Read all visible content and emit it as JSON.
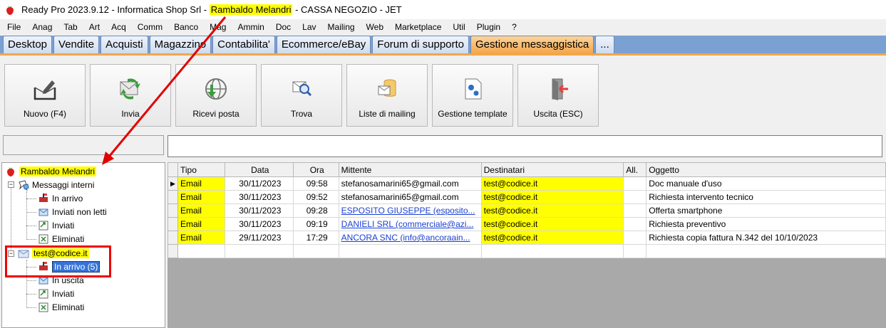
{
  "window": {
    "title_prefix": "Ready Pro 2023.9.12 - Informatica Shop Srl - ",
    "title_user": "Rambaldo Melandri",
    "title_suffix": " - CASSA NEGOZIO - JET"
  },
  "menu": [
    "File",
    "Anag",
    "Tab",
    "Art",
    "Acq",
    "Comm",
    "Banco",
    "Mag",
    "Ammin",
    "Doc",
    "Lav",
    "Mailing",
    "Web",
    "Marketplace",
    "Util",
    "Plugin",
    "?"
  ],
  "tabs": [
    {
      "label": "Desktop",
      "active": false
    },
    {
      "label": "Vendite",
      "active": false
    },
    {
      "label": "Acquisti",
      "active": false
    },
    {
      "label": "Magazzino",
      "active": false
    },
    {
      "label": "Contabilita'",
      "active": false
    },
    {
      "label": "Ecommerce/eBay",
      "active": false
    },
    {
      "label": "Forum di supporto",
      "active": false
    },
    {
      "label": "Gestione messaggistica",
      "active": true
    },
    {
      "label": "...",
      "active": false
    }
  ],
  "toolbar": {
    "new_label": "Nuovo (F4)",
    "send_label": "Invia",
    "receive_label": "Ricevi posta",
    "find_label": "Trova",
    "mailing_lists_label": "Liste di mailing",
    "templates_label": "Gestione template",
    "exit_label": "Uscita (ESC)"
  },
  "search": {
    "left_value": "",
    "value": ""
  },
  "tree": {
    "root": "Rambaldo Melandri",
    "internal": {
      "label": "Messaggi interni",
      "items": [
        "In arrivo",
        "Inviati non letti",
        "Inviati",
        "Eliminati"
      ]
    },
    "account": {
      "label": "test@codice.it",
      "items": [
        "In arrivo (5)",
        "In uscita",
        "Inviati",
        "Eliminati"
      ]
    }
  },
  "grid": {
    "columns": [
      "Tipo",
      "Data",
      "Ora",
      "Mittente",
      "Destinatari",
      "All.",
      "Oggetto"
    ],
    "rows": [
      {
        "tipo": "Email",
        "data": "30/11/2023",
        "ora": "09:58",
        "mittente": "stefanosamarini65@gmail.com",
        "dest": "test@codice.it",
        "all": "",
        "oggetto": "Doc manuale d'uso",
        "link": false
      },
      {
        "tipo": "Email",
        "data": "30/11/2023",
        "ora": "09:52",
        "mittente": "stefanosamarini65@gmail.com",
        "dest": "test@codice.it",
        "all": "",
        "oggetto": "Richiesta intervento tecnico",
        "link": false
      },
      {
        "tipo": "Email",
        "data": "30/11/2023",
        "ora": "09:28",
        "mittente": "ESPOSITO GIUSEPPE (esposito...",
        "dest": "test@codice.it",
        "all": "",
        "oggetto": "Offerta smartphone",
        "link": true
      },
      {
        "tipo": "Email",
        "data": "30/11/2023",
        "ora": "09:19",
        "mittente": "DANIELI SRL (commerciale@azi...",
        "dest": "test@codice.it",
        "all": "",
        "oggetto": "Richiesta preventivo",
        "link": true
      },
      {
        "tipo": "Email",
        "data": "29/11/2023",
        "ora": "17:29",
        "mittente": "ANCORA SNC (info@ancoraain...",
        "dest": "test@codice.it",
        "all": "",
        "oggetto": "Richiesta copia fattura N.342 del 10/10/2023",
        "link": true
      }
    ]
  },
  "colors": {
    "highlight": "#ffff00",
    "annotation": "#e00000",
    "tab_active": "#f4a64c",
    "tabbar": "#7aa1d2"
  }
}
